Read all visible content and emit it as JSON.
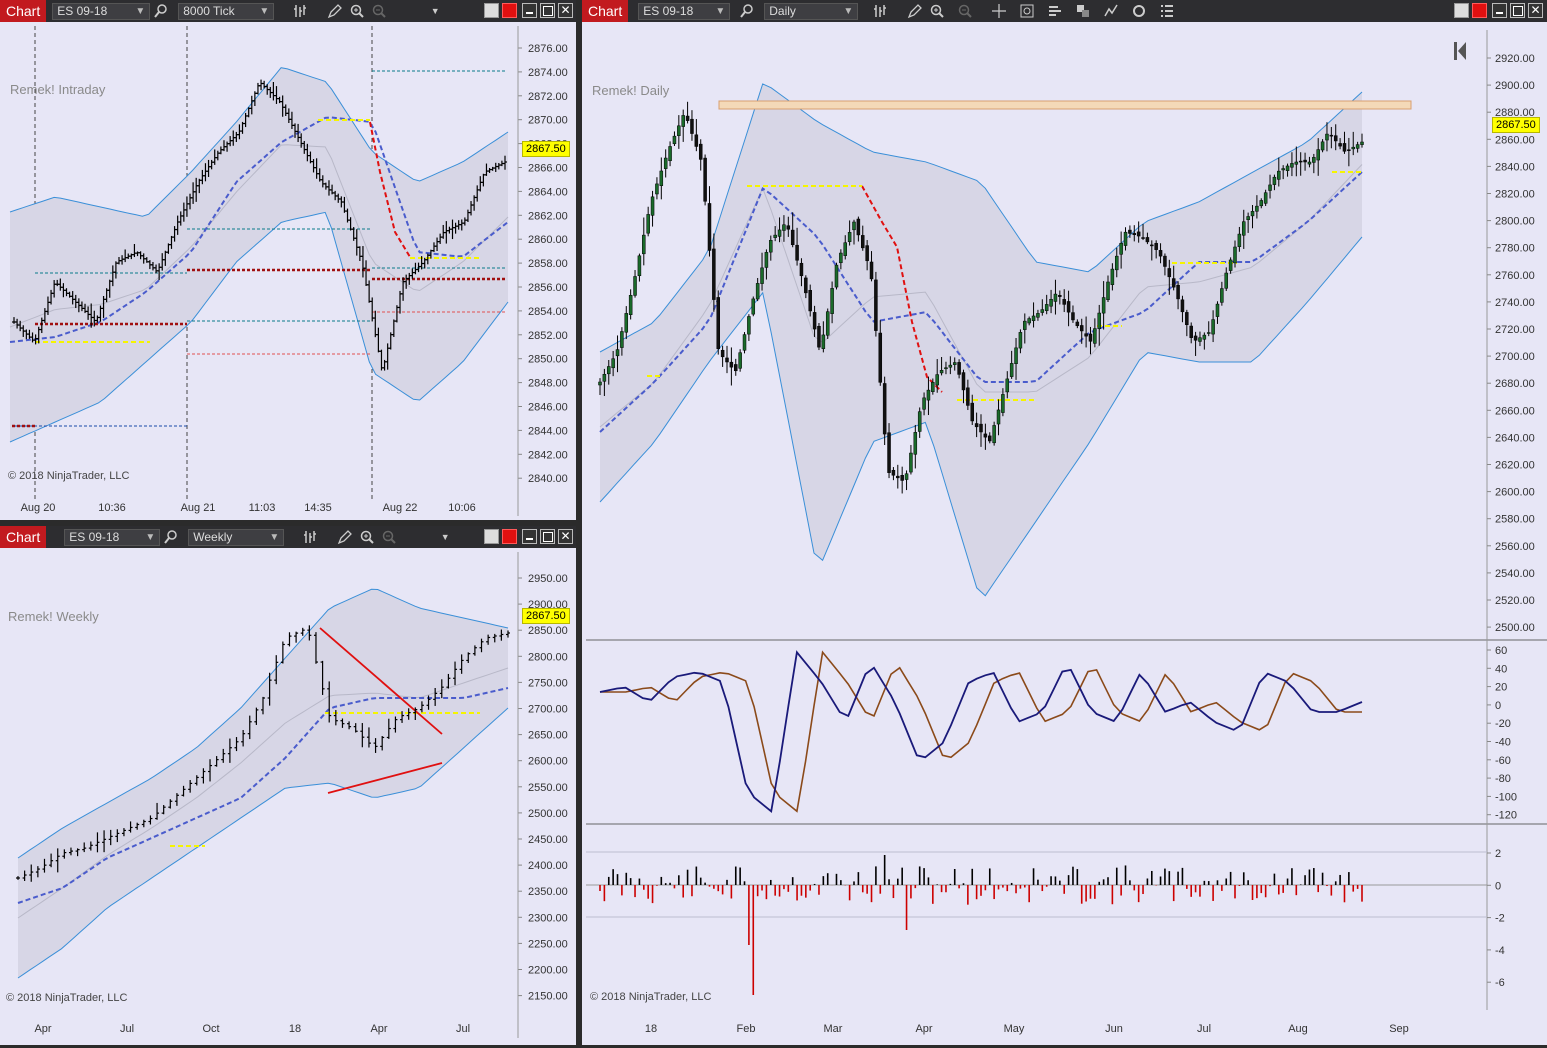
{
  "windows": {
    "intraday": {
      "tab": "Chart",
      "instrument": "ES 09-18",
      "period": "8000 Tick",
      "title": "Remek! Intraday",
      "copyright": "© 2018 NinjaTrader, LLC",
      "price_label": "2867.50",
      "y_ticks": [
        "2876.00",
        "2874.00",
        "2872.00",
        "2870.00",
        "2868.00",
        "2866.00",
        "2864.00",
        "2862.00",
        "2860.00",
        "2858.00",
        "2856.00",
        "2854.00",
        "2852.00",
        "2850.00",
        "2848.00",
        "2846.00",
        "2844.00",
        "2842.00",
        "2840.00"
      ],
      "x_ticks": [
        "Aug 20",
        "10:36",
        "Aug 21",
        "11:03",
        "14:35",
        "Aug 22",
        "10:06"
      ]
    },
    "weekly": {
      "tab": "Chart",
      "instrument": "ES 09-18",
      "period": "Weekly",
      "title": "Remek! Weekly",
      "copyright": "© 2018 NinjaTrader, LLC",
      "price_label": "2867.50",
      "y_ticks": [
        "2950.00",
        "2900.00",
        "2850.00",
        "2800.00",
        "2750.00",
        "2700.00",
        "2650.00",
        "2600.00",
        "2550.00",
        "2500.00",
        "2450.00",
        "2400.00",
        "2350.00",
        "2300.00",
        "2250.00",
        "2200.00",
        "2150.00"
      ],
      "x_ticks": [
        "Apr",
        "Jul",
        "Oct",
        "18",
        "Apr",
        "Jul"
      ]
    },
    "daily": {
      "tab": "Chart",
      "instrument": "ES 09-18",
      "period": "Daily",
      "title": "Remek! Daily",
      "copyright": "© 2018 NinjaTrader, LLC",
      "price_label": "2867.50",
      "y_ticks": [
        "2920.00",
        "2900.00",
        "2880.00",
        "2860.00",
        "2840.00",
        "2820.00",
        "2800.00",
        "2780.00",
        "2760.00",
        "2740.00",
        "2720.00",
        "2700.00",
        "2680.00",
        "2660.00",
        "2640.00",
        "2620.00",
        "2600.00",
        "2580.00",
        "2560.00",
        "2540.00",
        "2520.00",
        "2500.00"
      ],
      "osc_ticks": [
        "60",
        "40",
        "20",
        "0",
        "-20",
        "-40",
        "-60",
        "-80",
        "-100",
        "-120"
      ],
      "hist_ticks": [
        "2",
        "0",
        "-2",
        "-4",
        "-6"
      ],
      "x_ticks": [
        "18",
        "Feb",
        "Mar",
        "Apr",
        "May",
        "Jun",
        "Jul",
        "Aug",
        "Sep"
      ]
    }
  },
  "colors": {
    "panel_bg": "#e7e6f6",
    "band_line": "#3a8fd8",
    "dashed_ma": "#4a5ccc",
    "trend_red": "#e01010",
    "level_yellow": "#f5f500",
    "stoch_k": "#1a1a7a",
    "stoch_d": "#8b4a1a",
    "hist_up": "#000000",
    "hist_down": "#cc0000"
  }
}
